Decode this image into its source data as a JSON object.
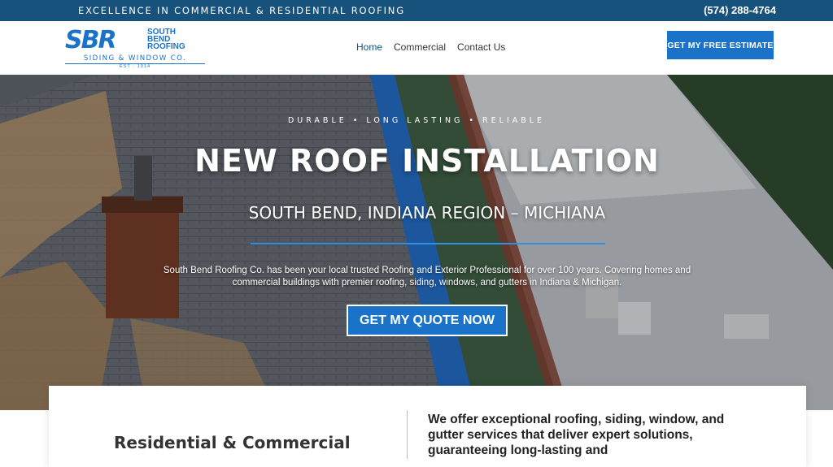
{
  "topbar": {
    "tagline": "EXCELLENCE IN COMMERCIAL & RESIDENTIAL ROOFING",
    "phone": "(574) 288-4764"
  },
  "logo": {
    "monogram": "SBR",
    "name_line1": "SOUTH",
    "name_line2": "BEND",
    "name_line3": "ROOFING",
    "subtitle": "SIDING & WINDOW CO.",
    "est": "EST · 1914"
  },
  "nav": {
    "items": [
      {
        "label": "Home",
        "active": true
      },
      {
        "label": "Commercial",
        "active": false
      },
      {
        "label": "Contact Us",
        "active": false
      }
    ]
  },
  "header": {
    "cta_label": "GET MY FREE ESTIMATE"
  },
  "hero": {
    "kicker": "DURABLE • LONG LASTING • RELIABLE",
    "title": "NEW ROOF INSTALLATION",
    "region": "SOUTH BEND, INDIANA REGION – MICHIANA",
    "description": "South Bend Roofing Co. has been your local trusted Roofing and Exterior Professional for over 100 years. Covering homes and commercial buildings with premier roofing, siding, windows, and gutters in Indiana & Michigan.",
    "button_label": "GET MY QUOTE NOW"
  },
  "content": {
    "heading": "Residential & Commercial",
    "intro": "We offer exceptional roofing, siding, window, and gutter services that deliver expert solutions, guaranteeing long-lasting and"
  },
  "colors": {
    "topbar": "#17527d",
    "accent": "#1a73c9"
  }
}
